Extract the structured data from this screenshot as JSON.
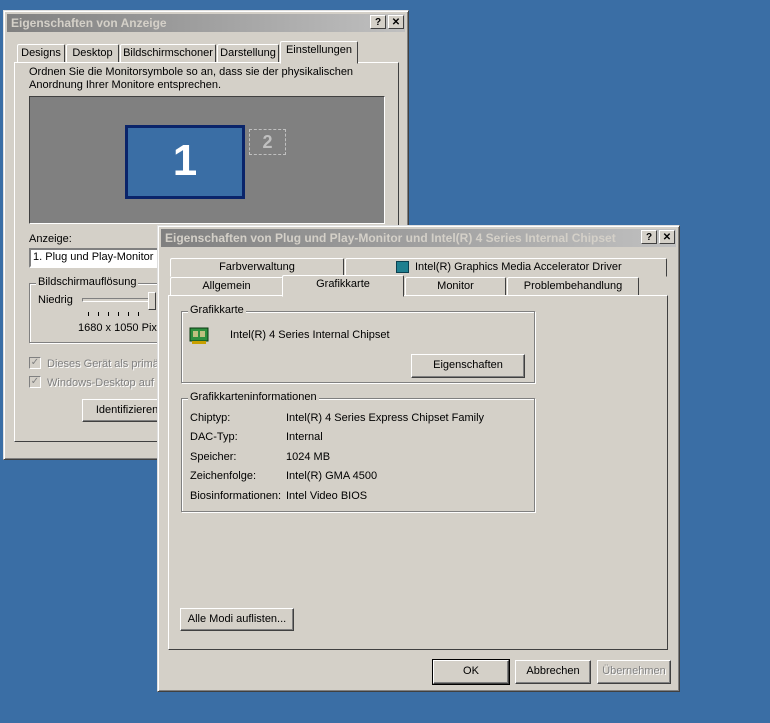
{
  "back_window": {
    "title": "Eigenschaften von Anzeige",
    "help_btn": "?",
    "close_btn": "✕",
    "tabs": [
      "Designs",
      "Desktop",
      "Bildschirmschoner",
      "Darstellung",
      "Einstellungen"
    ],
    "instruction": "Ordnen Sie die Monitorsymbole so an, dass sie der physikalischen Anordnung Ihrer Monitore entsprechen.",
    "monitor1": "1",
    "monitor2": "2",
    "display_label": "Anzeige:",
    "display_value": "1. Plug und Play-Monitor m",
    "resolution_group": "Bildschirmauflösung",
    "low_label": "Niedrig",
    "resolution_value": "1680 x 1050 Pixe",
    "check_primary": "Dieses Gerät als primäre",
    "check_extend": "Windows-Desktop auf d",
    "identify_btn": "Identifizieren"
  },
  "front_window": {
    "title": "Eigenschaften von Plug und Play-Monitor und Intel(R) 4 Series Internal Chipset",
    "help_btn": "?",
    "close_btn": "✕",
    "tabs_back": [
      "Farbverwaltung",
      "Intel(R) Graphics Media Accelerator Driver"
    ],
    "tabs_front": [
      "Allgemein",
      "Grafikkarte",
      "Monitor",
      "Problembehandlung"
    ],
    "adapter_group": "Grafikkarte",
    "adapter_name": "Intel(R) 4 Series Internal Chipset",
    "properties_btn": "Eigenschaften",
    "info_group": "Grafikkarteninformationen",
    "info": [
      {
        "label": "Chiptyp:",
        "value": "Intel(R) 4 Series Express Chipset Family"
      },
      {
        "label": "DAC-Typ:",
        "value": "Internal"
      },
      {
        "label": "Speicher:",
        "value": "1024 MB"
      },
      {
        "label": "Zeichenfolge:",
        "value": "Intel(R) GMA 4500"
      },
      {
        "label": "Biosinformationen:",
        "value": "Intel Video BIOS"
      }
    ],
    "list_modes_btn": "Alle Modi auflisten...",
    "ok_btn": "OK",
    "cancel_btn": "Abbrechen",
    "apply_btn": "Übernehmen"
  },
  "icons": {
    "adapter": "graphics-card-icon",
    "intel": "intel-gma-icon"
  }
}
